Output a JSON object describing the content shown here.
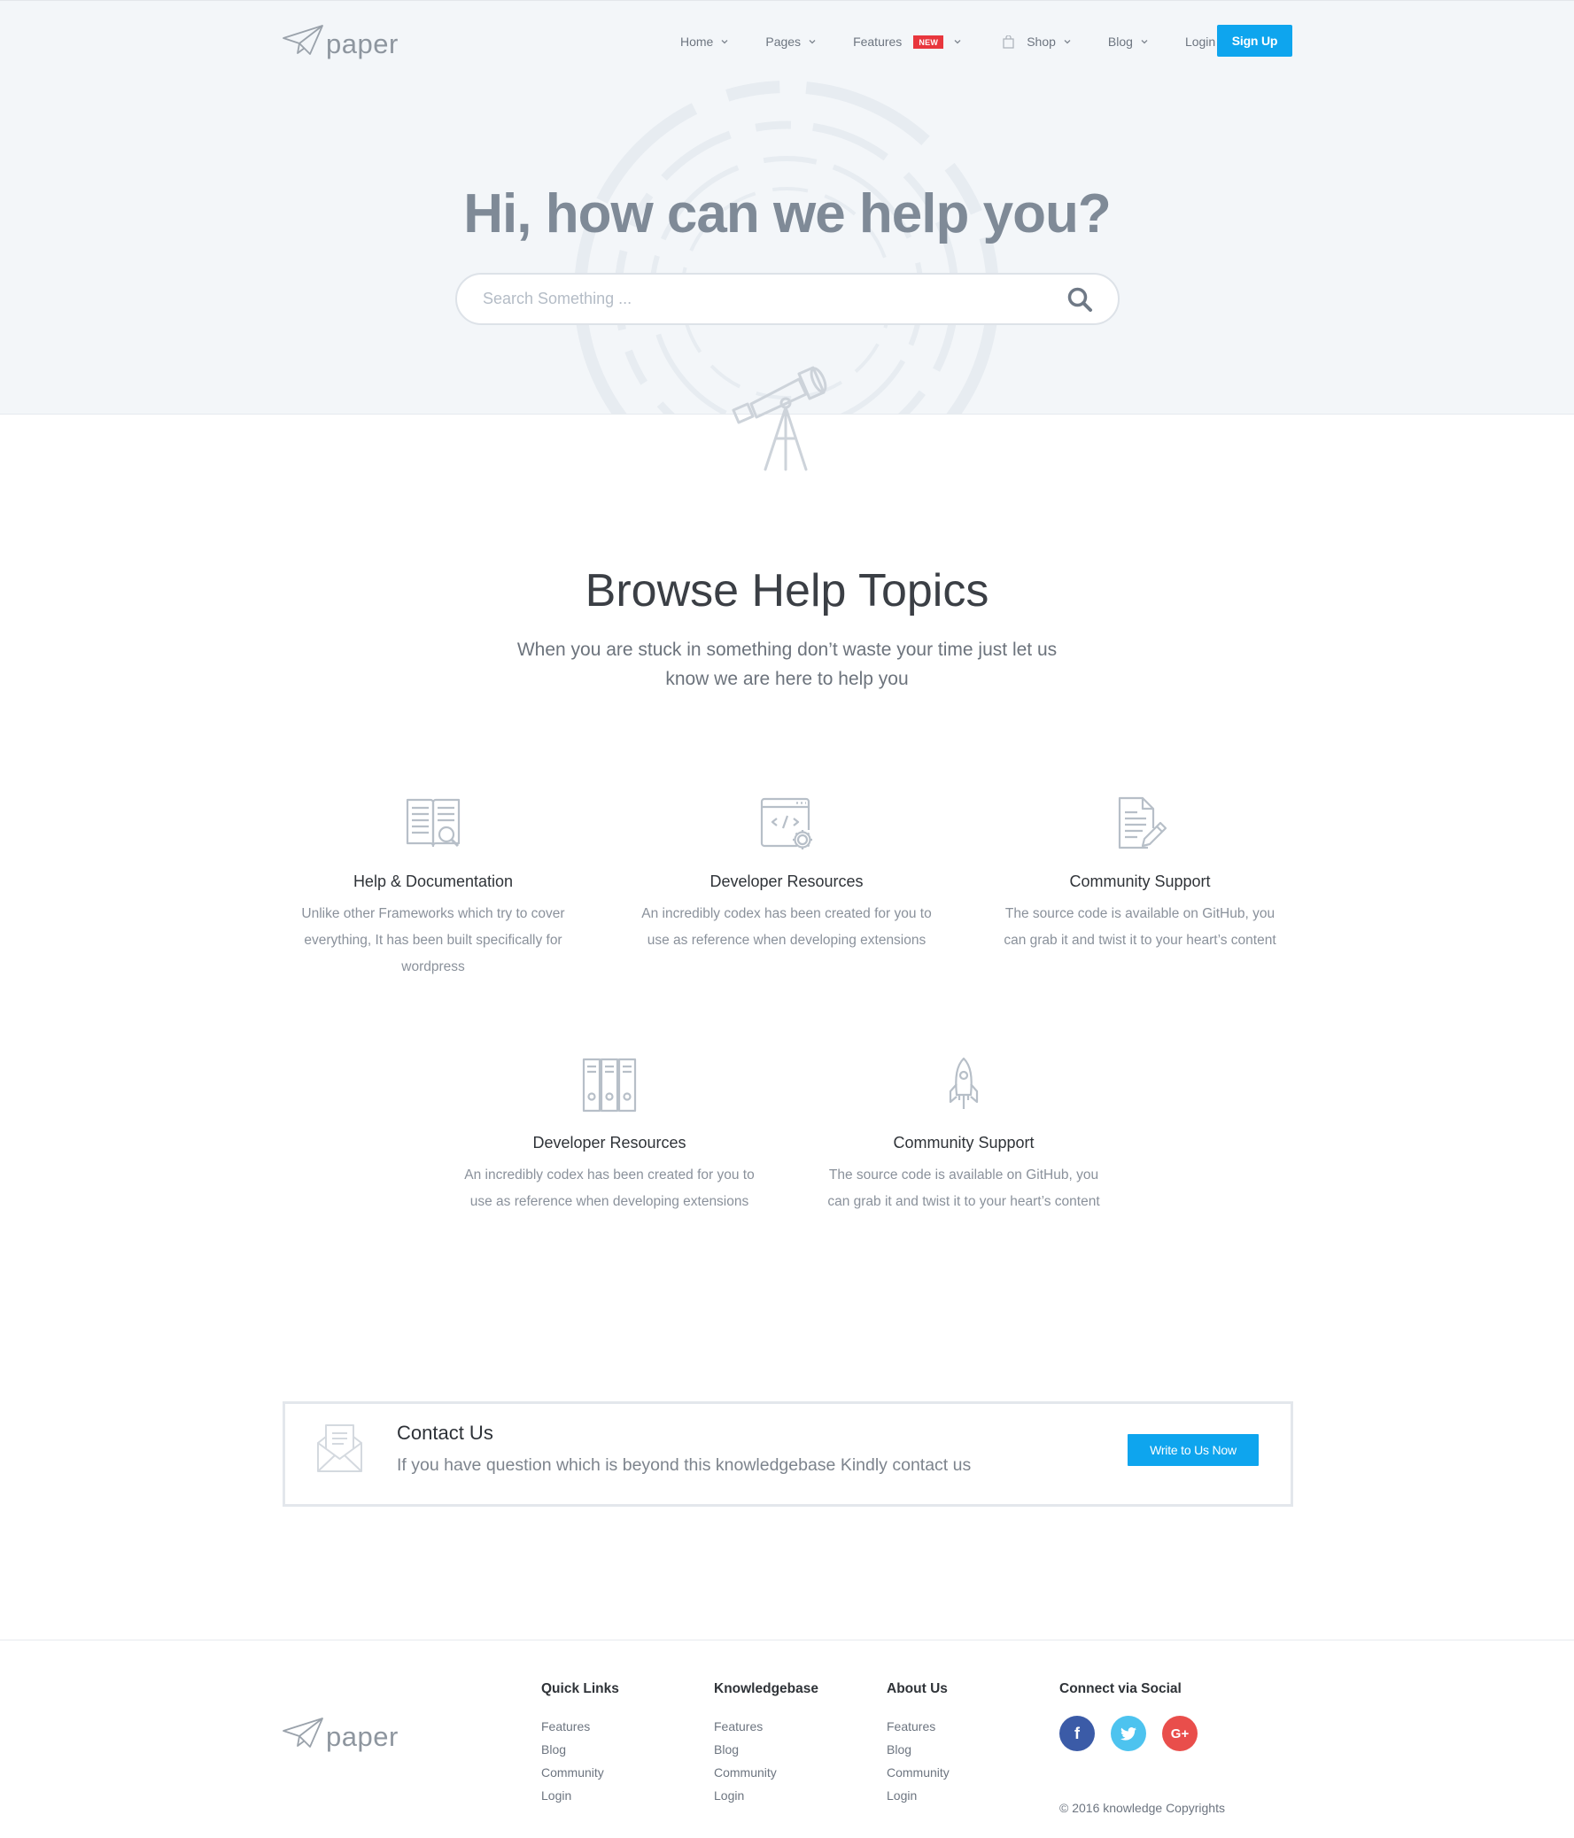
{
  "brand": {
    "name": "paper"
  },
  "nav": {
    "items": [
      {
        "label": "Home"
      },
      {
        "label": "Pages"
      },
      {
        "label": "Features",
        "badge": "NEW"
      },
      {
        "label": "Shop"
      },
      {
        "label": "Blog"
      },
      {
        "label": "Login"
      }
    ],
    "signup_label": "Sign Up"
  },
  "hero": {
    "title": "Hi, how can we help you?",
    "search_placeholder": "Search Something ..."
  },
  "browse": {
    "title": "Browse Help Topics",
    "subtitle": "When you are stuck in something don’t waste your time just let us know we are here to help you",
    "topics": [
      {
        "icon": "book-search-icon",
        "title": "Help & Documentation",
        "desc": "Unlike other Frameworks which try to cover everything, It has been built specifically for wordpress"
      },
      {
        "icon": "code-window-gear-icon",
        "title": "Developer Resources",
        "desc": "An incredibly codex has been created for you to use as reference when developing extensions"
      },
      {
        "icon": "document-pen-icon",
        "title": "Community Support",
        "desc": "The source code is available on GitHub, you can grab it and twist it to your heart’s content"
      },
      {
        "icon": "binders-icon",
        "title": "Developer Resources",
        "desc": "An incredibly codex has been created for you to use as reference when developing extensions"
      },
      {
        "icon": "rocket-icon",
        "title": "Community Support",
        "desc": "The source code is available on GitHub, you can grab it and twist it to your heart’s content"
      }
    ]
  },
  "contact": {
    "title": "Contact Us",
    "desc": "If you have question which is beyond this knowledgebase Kindly contact us",
    "button": "Write to Us Now"
  },
  "footer": {
    "columns": [
      {
        "title": "Quick Links",
        "links": [
          "Features",
          "Blog",
          "Community",
          "Login"
        ]
      },
      {
        "title": "Knowledgebase",
        "links": [
          "Features",
          "Blog",
          "Community",
          "Login"
        ]
      },
      {
        "title": "About Us",
        "links": [
          "Features",
          "Blog",
          "Community",
          "Login"
        ]
      }
    ],
    "social_title": "Connect via Social",
    "social": [
      {
        "icon": "facebook-icon",
        "glyph": "f",
        "color": "#3b5ba7"
      },
      {
        "icon": "twitter-icon",
        "glyph": "t",
        "color": "#4dc3ef"
      },
      {
        "icon": "google-plus-icon",
        "glyph": "G+",
        "color": "#e94e4b"
      }
    ],
    "copyright": "© 2016 knowledge Copyrights"
  },
  "colors": {
    "accent": "#0ea5ee",
    "badge": "#e8363d",
    "hero_bg": "#f3f6f9"
  }
}
